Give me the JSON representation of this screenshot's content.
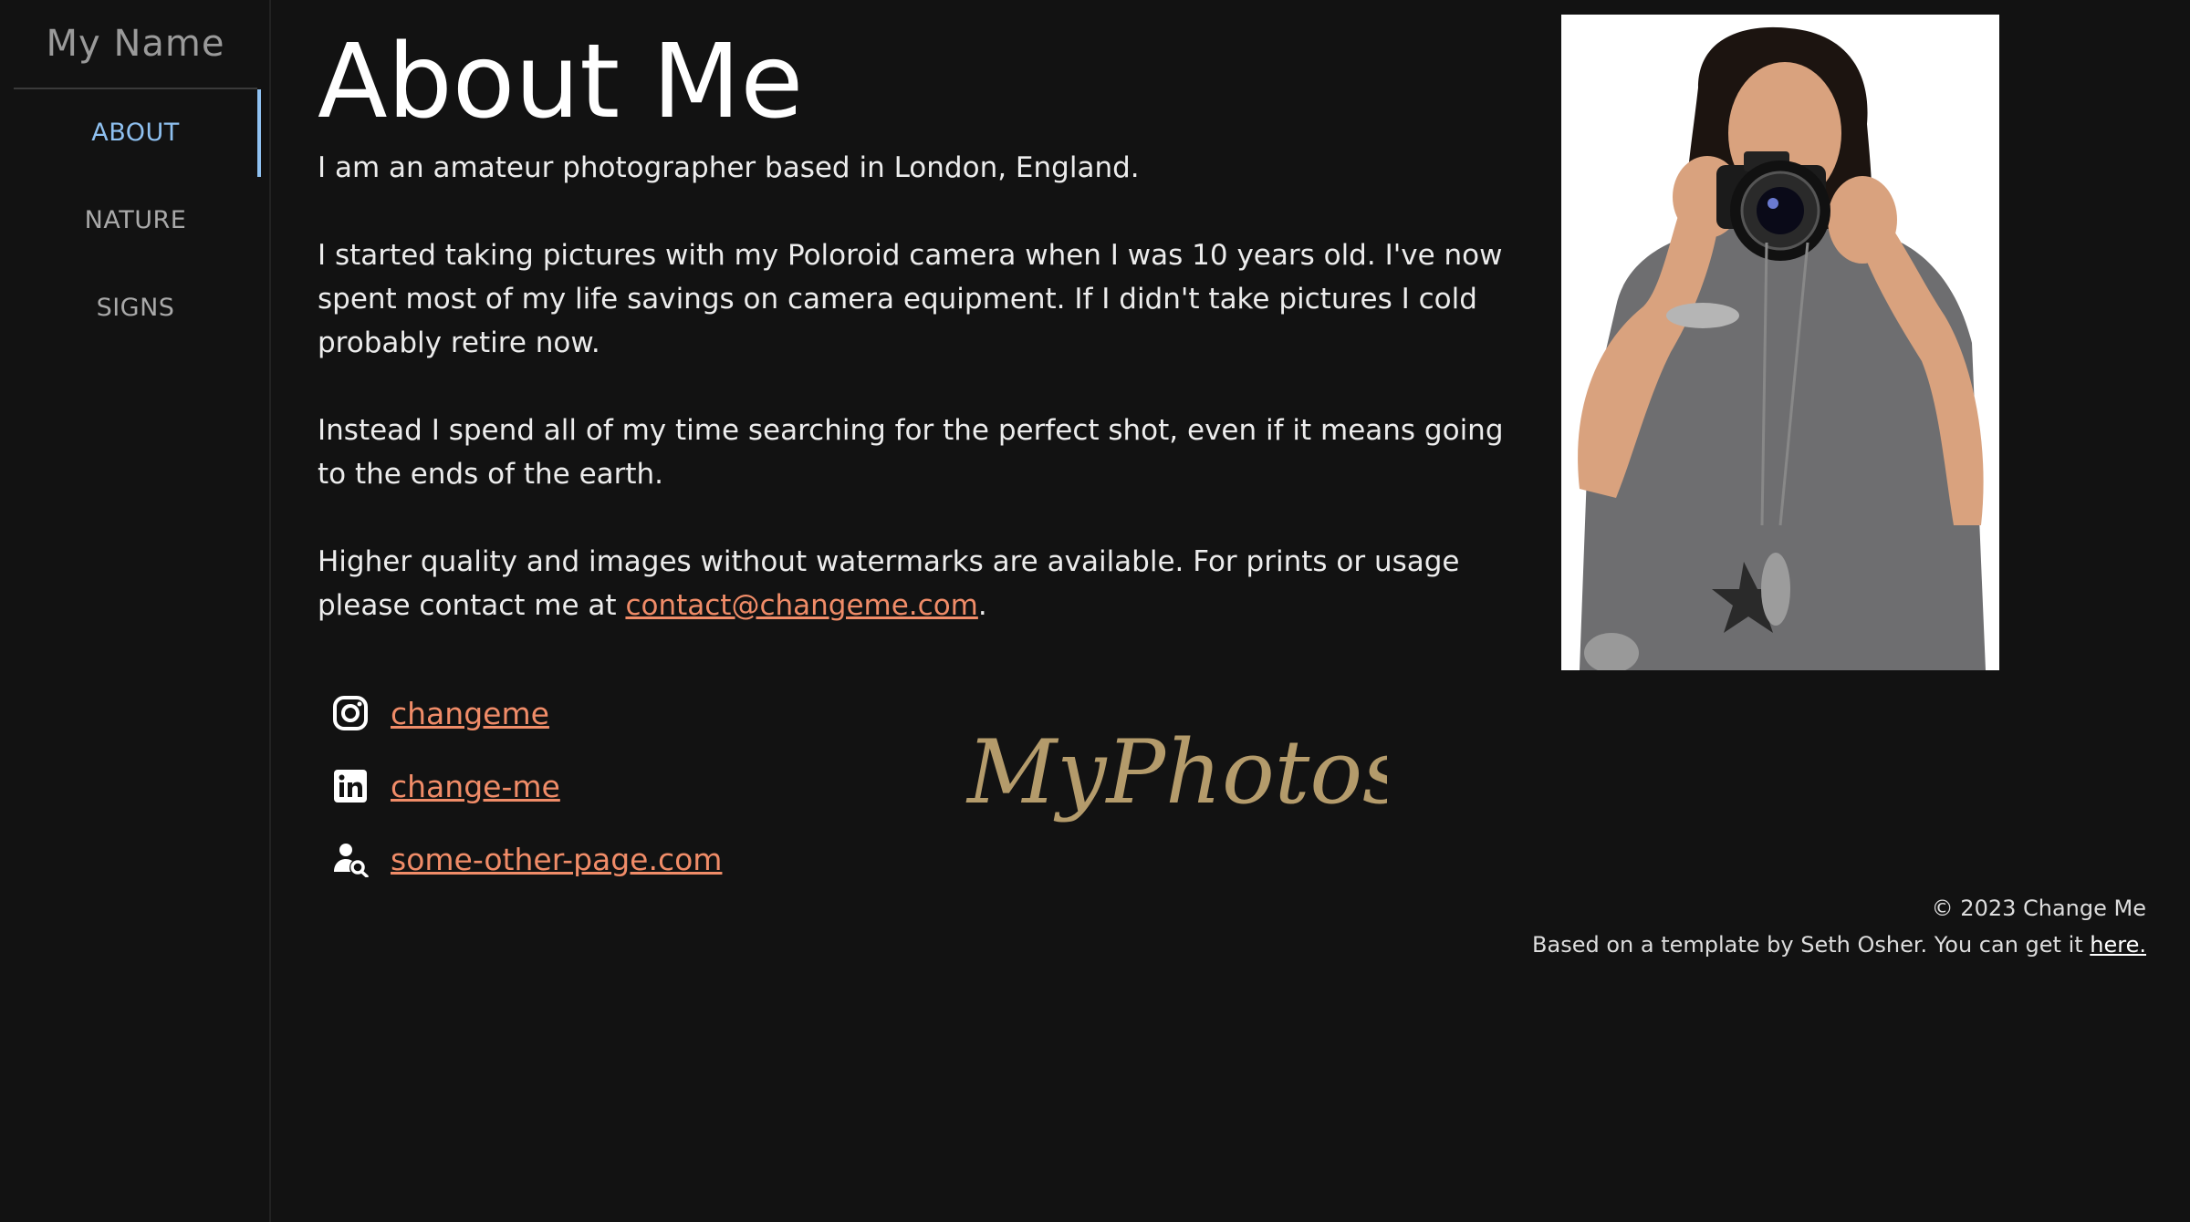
{
  "sidebar": {
    "site_name": "My Name",
    "items": [
      {
        "label": "ABOUT",
        "active": true
      },
      {
        "label": "NATURE",
        "active": false
      },
      {
        "label": "SIGNS",
        "active": false
      }
    ]
  },
  "main": {
    "title": "About Me",
    "paragraphs": [
      "I am an amateur photographer based in London, England.",
      "I started taking pictures with my Poloroid camera when I was 10 years old. I've now spent most of my life savings on camera equipment. If I didn't take pictures I cold probably retire now.",
      "Instead I spend all of my time searching for the perfect shot, even if it means going to the ends of the earth."
    ],
    "contact_prefix": "Higher quality and images without watermarks are available. For prints or usage please contact me at ",
    "contact_email": "contact@changeme.com",
    "contact_suffix": "."
  },
  "social": [
    {
      "icon": "instagram-icon",
      "label": "changeme"
    },
    {
      "icon": "linkedin-icon",
      "label": "change-me"
    },
    {
      "icon": "user-search-icon",
      "label": "some-other-page.com"
    }
  ],
  "logo_text": "MyPhotos.com",
  "footer": {
    "copyright": "© 2023 Change Me",
    "template_text": "Based on a template by Seth Osher. You can get it ",
    "template_link": "here."
  },
  "colors": {
    "background": "#121212",
    "accent_link": "#f08c68",
    "nav_active": "#8fc1f1",
    "logo": "#b49b6b"
  }
}
